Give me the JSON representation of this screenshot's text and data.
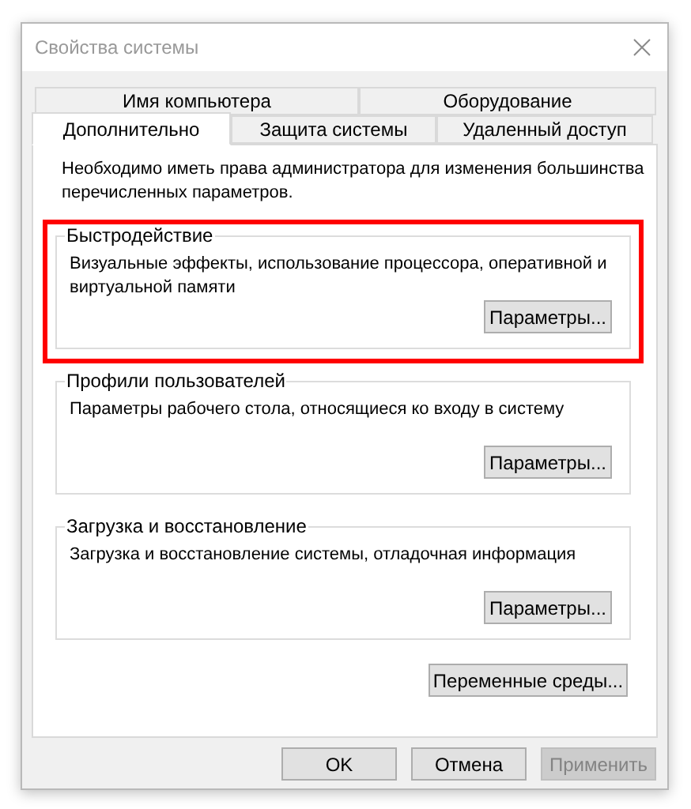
{
  "window": {
    "title": "Свойства системы"
  },
  "tab_rows": [
    [
      {
        "label": "Имя компьютера",
        "selected": false
      },
      {
        "label": "Оборудование",
        "selected": false
      }
    ],
    [
      {
        "label": "Дополнительно",
        "selected": true
      },
      {
        "label": "Защита системы",
        "selected": false
      },
      {
        "label": "Удаленный доступ",
        "selected": false
      }
    ]
  ],
  "notice": "Необходимо иметь права администратора для изменения большинства перечисленных параметров.",
  "groups": [
    {
      "title": "Быстродействие",
      "description": "Визуальные эффекты, использование процессора, оперативной и виртуальной памяти",
      "button": "Параметры...",
      "highlighted": true
    },
    {
      "title": "Профили пользователей",
      "description": "Параметры рабочего стола, относящиеся ко входу в систему",
      "button": "Параметры...",
      "highlighted": false
    },
    {
      "title": "Загрузка и восстановление",
      "description": "Загрузка и восстановление системы, отладочная информация",
      "button": "Параметры...",
      "highlighted": false
    }
  ],
  "env_button": "Переменные среды...",
  "buttons": [
    {
      "label": "OK",
      "disabled": false
    },
    {
      "label": "Отмена",
      "disabled": false
    },
    {
      "label": "Применить",
      "disabled": true
    }
  ]
}
